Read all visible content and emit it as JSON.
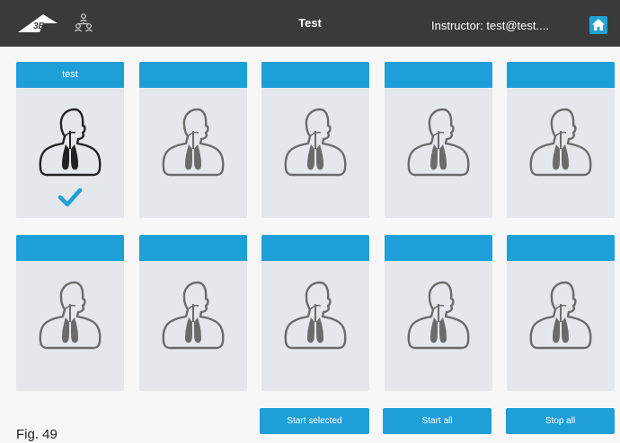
{
  "header": {
    "title": "Test",
    "instructor": "Instructor: test@test....",
    "logo_icon": "3b-logo",
    "network_icon": "network-people-icon",
    "home_icon": "home-icon"
  },
  "stations": [
    {
      "label": "test",
      "active": true,
      "selected": true
    },
    {
      "label": "",
      "active": false,
      "selected": false
    },
    {
      "label": "",
      "active": false,
      "selected": false
    },
    {
      "label": "",
      "active": false,
      "selected": false
    },
    {
      "label": "",
      "active": false,
      "selected": false
    },
    {
      "label": "",
      "active": false,
      "selected": false
    },
    {
      "label": "",
      "active": false,
      "selected": false
    },
    {
      "label": "",
      "active": false,
      "selected": false
    },
    {
      "label": "",
      "active": false,
      "selected": false
    },
    {
      "label": "",
      "active": false,
      "selected": false
    }
  ],
  "buttons": {
    "start_selected": "Start selected",
    "start_all": "Start all",
    "stop_all": "Stop all"
  },
  "caption": "Fig. 49",
  "colors": {
    "accent": "#1f9fd8",
    "topbar": "#3a3a3a",
    "card": "#e4e7ec",
    "figure_active": "#222222",
    "figure_inactive": "#6b6b6b"
  }
}
